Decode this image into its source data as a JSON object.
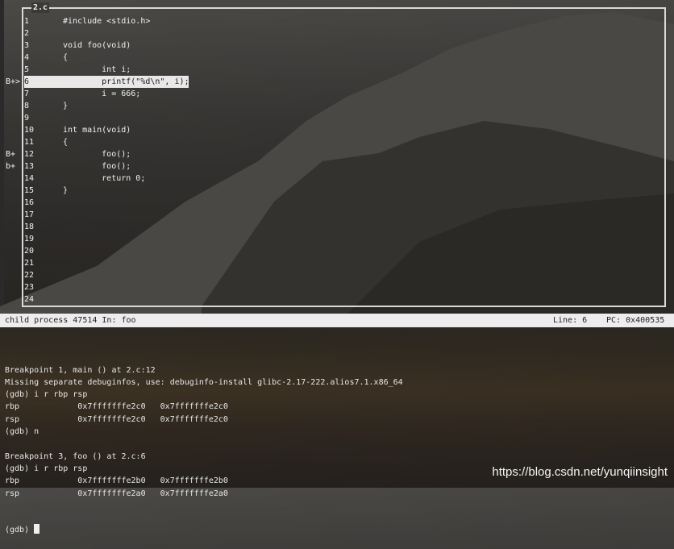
{
  "source_window": {
    "title": "2.c",
    "lines": [
      {
        "num": "1",
        "code": "#include <stdio.h>"
      },
      {
        "num": "2",
        "code": ""
      },
      {
        "num": "3",
        "code": "void foo(void)"
      },
      {
        "num": "4",
        "code": "{"
      },
      {
        "num": "5",
        "code": "        int i;"
      },
      {
        "num": "6",
        "code": "        printf(\"%d\\n\", i);"
      },
      {
        "num": "7",
        "code": "        i = 666;"
      },
      {
        "num": "8",
        "code": "}"
      },
      {
        "num": "9",
        "code": ""
      },
      {
        "num": "10",
        "code": "int main(void)"
      },
      {
        "num": "11",
        "code": "{"
      },
      {
        "num": "12",
        "code": "        foo();"
      },
      {
        "num": "13",
        "code": "        foo();"
      },
      {
        "num": "14",
        "code": "        return 0;"
      },
      {
        "num": "15",
        "code": "}"
      },
      {
        "num": "16",
        "code": ""
      },
      {
        "num": "17",
        "code": ""
      },
      {
        "num": "18",
        "code": ""
      },
      {
        "num": "19",
        "code": ""
      },
      {
        "num": "20",
        "code": ""
      },
      {
        "num": "21",
        "code": ""
      },
      {
        "num": "22",
        "code": ""
      },
      {
        "num": "23",
        "code": ""
      },
      {
        "num": "24",
        "code": ""
      }
    ],
    "current_line": "6",
    "breakpoint_markers": {
      "6": "B+>",
      "12": "B+",
      "13": "b+"
    }
  },
  "status_bar": {
    "process": "child process 47514 In: foo",
    "line": "Line: 6",
    "pc": "PC: 0x400535"
  },
  "console": {
    "lines": [
      "Breakpoint 1, main () at 2.c:12",
      "Missing separate debuginfos, use: debuginfo-install glibc-2.17-222.alios7.1.x86_64",
      "(gdb) i r rbp rsp",
      "rbp            0x7fffffffe2c0   0x7fffffffe2c0",
      "rsp            0x7fffffffe2c0   0x7fffffffe2c0",
      "(gdb) n",
      "",
      "Breakpoint 3, foo () at 2.c:6",
      "(gdb) i r rbp rsp",
      "rbp            0x7fffffffe2b0   0x7fffffffe2b0",
      "rsp            0x7fffffffe2a0   0x7fffffffe2a0"
    ],
    "prompt": "(gdb) "
  },
  "watermark": "https://blog.csdn.net/yunqiinsight"
}
